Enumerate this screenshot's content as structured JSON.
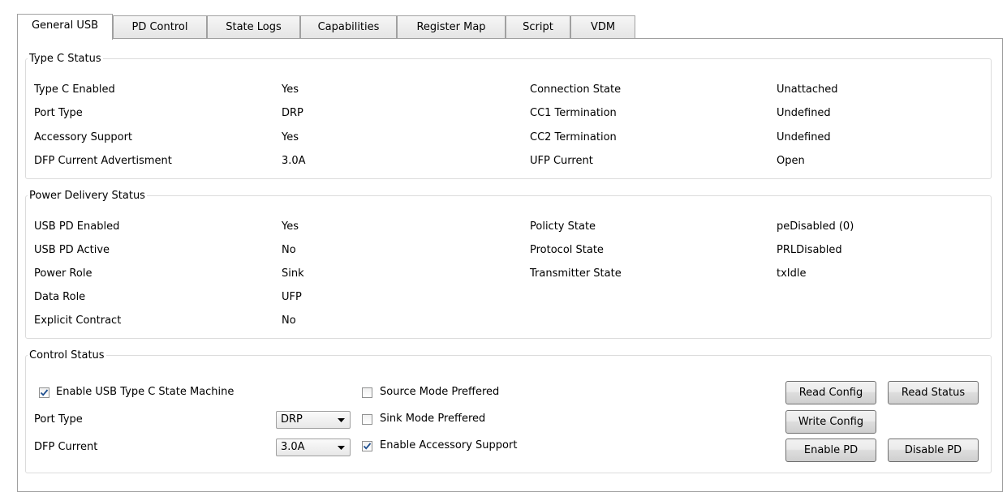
{
  "tabs": [
    {
      "label": "General USB"
    },
    {
      "label": "PD Control"
    },
    {
      "label": "State Logs"
    },
    {
      "label": "Capabilities"
    },
    {
      "label": "Register Map"
    },
    {
      "label": "Script"
    },
    {
      "label": "VDM"
    }
  ],
  "type_c_status": {
    "title": "Type C Status",
    "left": [
      {
        "label": "Type C Enabled",
        "value": "Yes"
      },
      {
        "label": "Port Type",
        "value": "DRP"
      },
      {
        "label": "Accessory Support",
        "value": "Yes"
      },
      {
        "label": "DFP Current Advertisment",
        "value": "3.0A"
      }
    ],
    "right": [
      {
        "label": "Connection State",
        "value": "Unattached"
      },
      {
        "label": "CC1 Termination",
        "value": "Undefined"
      },
      {
        "label": "CC2 Termination",
        "value": "Undefined"
      },
      {
        "label": "UFP Current",
        "value": "Open"
      }
    ]
  },
  "pd_status": {
    "title": "Power Delivery Status",
    "left": [
      {
        "label": "USB PD Enabled",
        "value": "Yes"
      },
      {
        "label": "USB PD Active",
        "value": "No"
      },
      {
        "label": "Power Role",
        "value": "Sink"
      },
      {
        "label": "Data Role",
        "value": "UFP"
      },
      {
        "label": "Explicit Contract",
        "value": "No"
      }
    ],
    "right": [
      {
        "label": "Policty State",
        "value": "peDisabled (0)"
      },
      {
        "label": "Protocol State",
        "value": "PRLDisabled"
      },
      {
        "label": "Transmitter State",
        "value": "txIdle"
      }
    ]
  },
  "control_status": {
    "title": "Control Status",
    "enable_state_machine": {
      "label": "Enable USB Type C State Machine",
      "checked": true
    },
    "port_type": {
      "label": "Port Type",
      "value": "DRP"
    },
    "dfp_current": {
      "label": "DFP Current",
      "value": "3.0A"
    },
    "source_mode": {
      "label": "Source Mode Preffered",
      "checked": false
    },
    "sink_mode": {
      "label": "Sink Mode Preffered",
      "checked": false
    },
    "accessory_support": {
      "label": "Enable Accessory Support",
      "checked": true
    },
    "buttons": {
      "read_config": "Read Config",
      "read_status": "Read Status",
      "write_config": "Write Config",
      "enable_pd": "Enable PD",
      "disable_pd": "Disable PD"
    }
  },
  "colors": {
    "border": "#a0a0a0",
    "group_border": "#dcdcdc",
    "check": "#1f4f8f"
  }
}
